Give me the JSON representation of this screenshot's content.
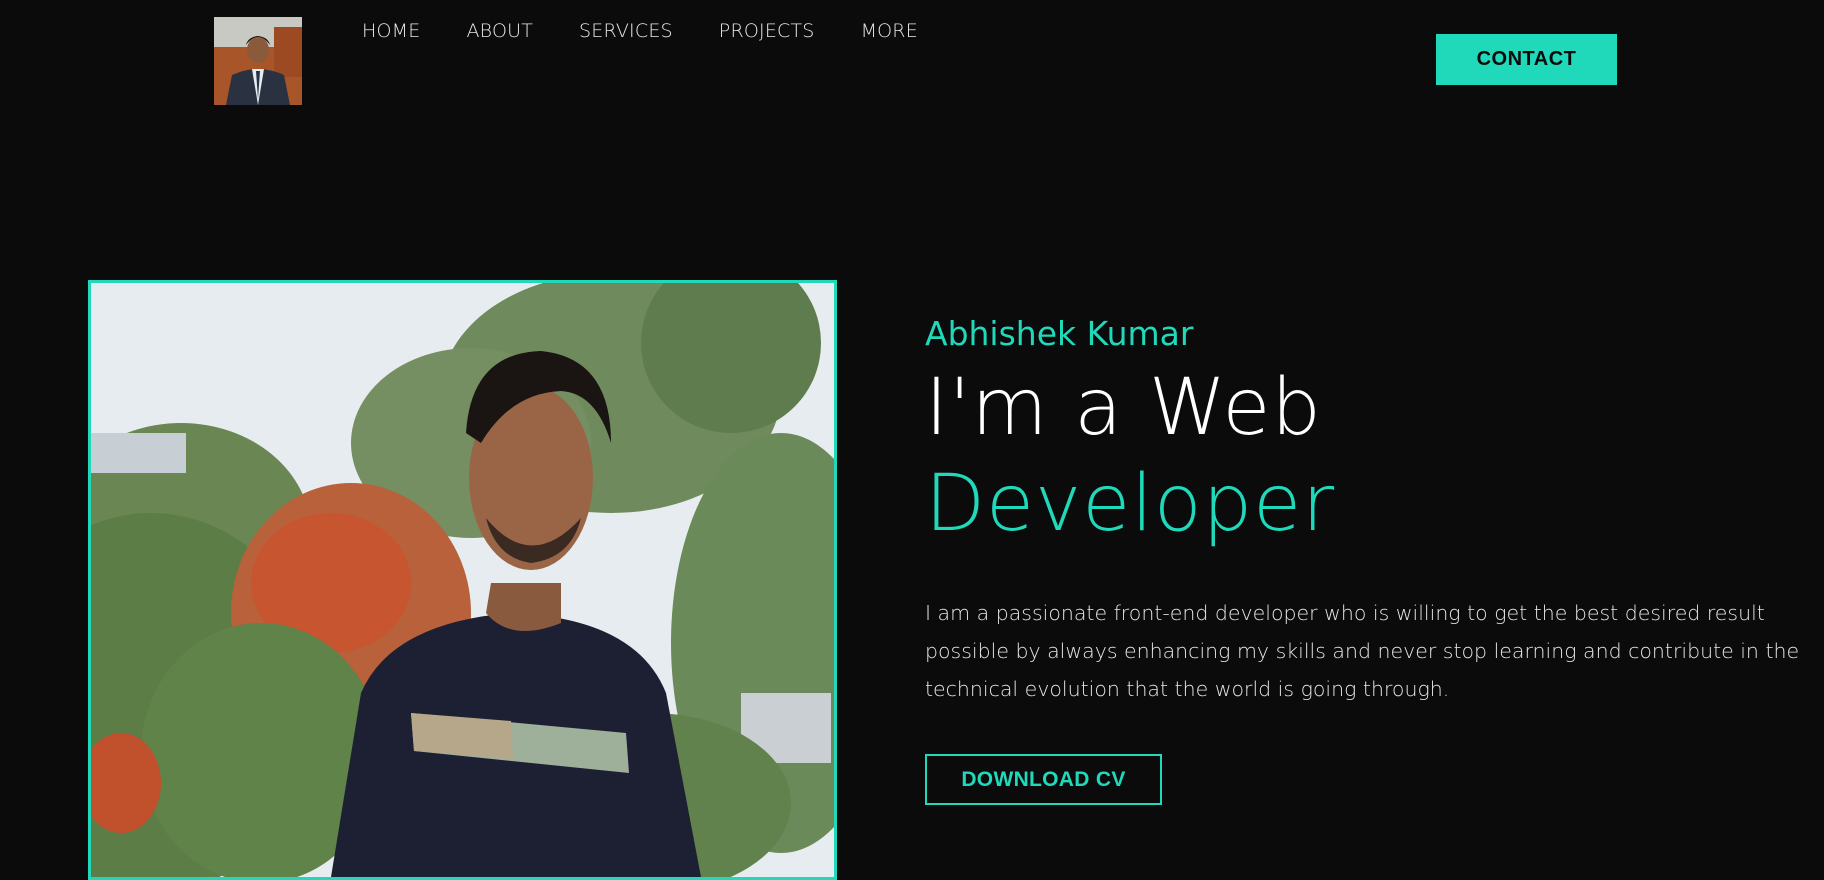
{
  "header": {
    "logo_alt": "Profile photo of Abhishek Kumar in a suit",
    "nav": [
      {
        "label": "HOME"
      },
      {
        "label": "ABOUT"
      },
      {
        "label": "SERVICES"
      },
      {
        "label": "PROJECTS"
      },
      {
        "label": "MORE"
      }
    ],
    "contact_label": "CONTACT"
  },
  "hero": {
    "name": "Abhishek Kumar",
    "title_line1": "I'm a Web",
    "title_line2": "Developer",
    "description": "I am a passionate front-end developer who is willing to get the best desired result possible by always enhancing my skills and never stop learning and contribute in the technical evolution that the world is going through.",
    "download_label": "DOWNLOAD CV",
    "photo_alt": "Smiling young man in a dark t-shirt outdoors with trees"
  },
  "colors": {
    "background": "#0b0b0c",
    "accent": "#20d9bb",
    "text": "#ffffff"
  }
}
